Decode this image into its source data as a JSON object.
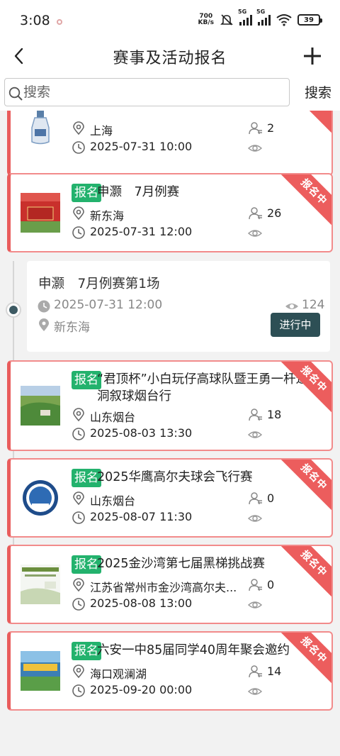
{
  "status_bar": {
    "time": "3:08",
    "net_speed_value": "700",
    "net_speed_unit": "KB/s",
    "signal1": "5G",
    "signal2": "5G",
    "battery": "39"
  },
  "nav": {
    "title": "赛事及活动报名"
  },
  "search": {
    "placeholder": "搜索",
    "button": "搜索"
  },
  "events": [
    {
      "tag": "",
      "title": "",
      "location": "上海",
      "datetime": "2025-07-31 10:00",
      "participants": "2"
    },
    {
      "tag": "报名",
      "title": "申灏　7月例赛",
      "location": "新东海",
      "datetime": "2025-07-31 12:00",
      "participants": "26",
      "ribbon": "报名中"
    },
    {
      "tag": "报名",
      "title_line1": "“君顶杯”小白玩仔高球队暨王勇一杆进",
      "title_line2": "洞叙球烟台行",
      "location": "山东烟台",
      "datetime": "2025-08-03 13:30",
      "participants": "18",
      "ribbon": "报名中"
    },
    {
      "tag": "报名",
      "title": "2025华鹰高尔夫球会飞行赛",
      "location": "山东烟台",
      "datetime": "2025-08-07 11:30",
      "participants": "0",
      "ribbon": "报名中"
    },
    {
      "tag": "报名",
      "title": "2025金沙湾第七届黑梯挑战赛",
      "location": "江苏省常州市金沙湾高尔夫...",
      "datetime": "2025-08-08 13:00",
      "participants": "0",
      "ribbon": "报名中"
    },
    {
      "tag": "报名",
      "title": "六安一中85届同学40周年聚会邀约",
      "location": "海口观澜湖",
      "datetime": "2025-09-20 00:00",
      "participants": "14",
      "ribbon": "报名中"
    }
  ],
  "sub_event": {
    "title": "申灏　7月例赛第1场",
    "datetime": "2025-07-31 12:00",
    "location": "新东海",
    "views": "124",
    "status": "进行中"
  },
  "colors": {
    "accent_red": "#ec5d5d",
    "tag_green": "#23b26d",
    "status_dark": "#2d4f55"
  }
}
